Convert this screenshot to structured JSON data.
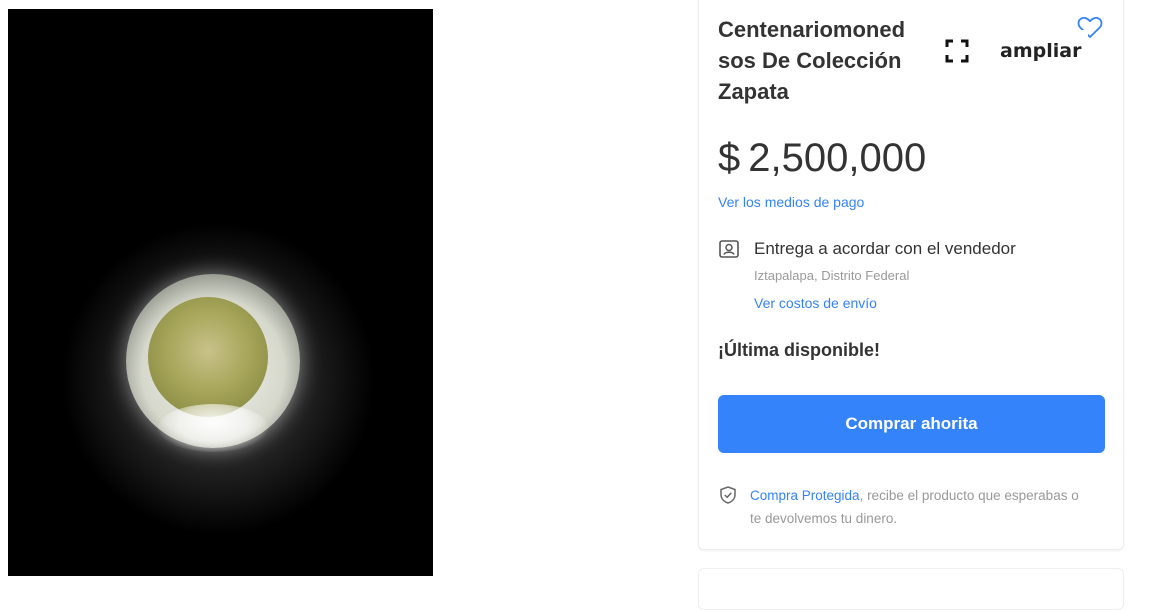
{
  "product": {
    "title_lines": [
      "Centenariomoned",
      "sos De Colección",
      "Zapata"
    ],
    "price_currency": "$",
    "price_amount": "2,500,000",
    "payment_link": "Ver los medios de pago"
  },
  "shipping": {
    "title": "Entrega a acordar con el vendedor",
    "location": "Iztapalapa, Distrito Federal",
    "costs_link": "Ver costos de envío"
  },
  "stock": {
    "label": "¡Última disponible!"
  },
  "buy_button": {
    "label": "Comprar ahorita"
  },
  "protection": {
    "link": "Compra Protegida",
    "text": ", recibe el producto que esperabas o te devolvemos tu dinero."
  },
  "overlay": {
    "expand_label": "ampliar",
    "expand_icon": "expand-icon"
  },
  "icons": {
    "favorite": "heart-icon",
    "shipping": "user-card-icon",
    "protection": "shield-check-icon"
  },
  "colors": {
    "accent": "#3483fa",
    "text": "#333333",
    "muted": "#999999"
  }
}
